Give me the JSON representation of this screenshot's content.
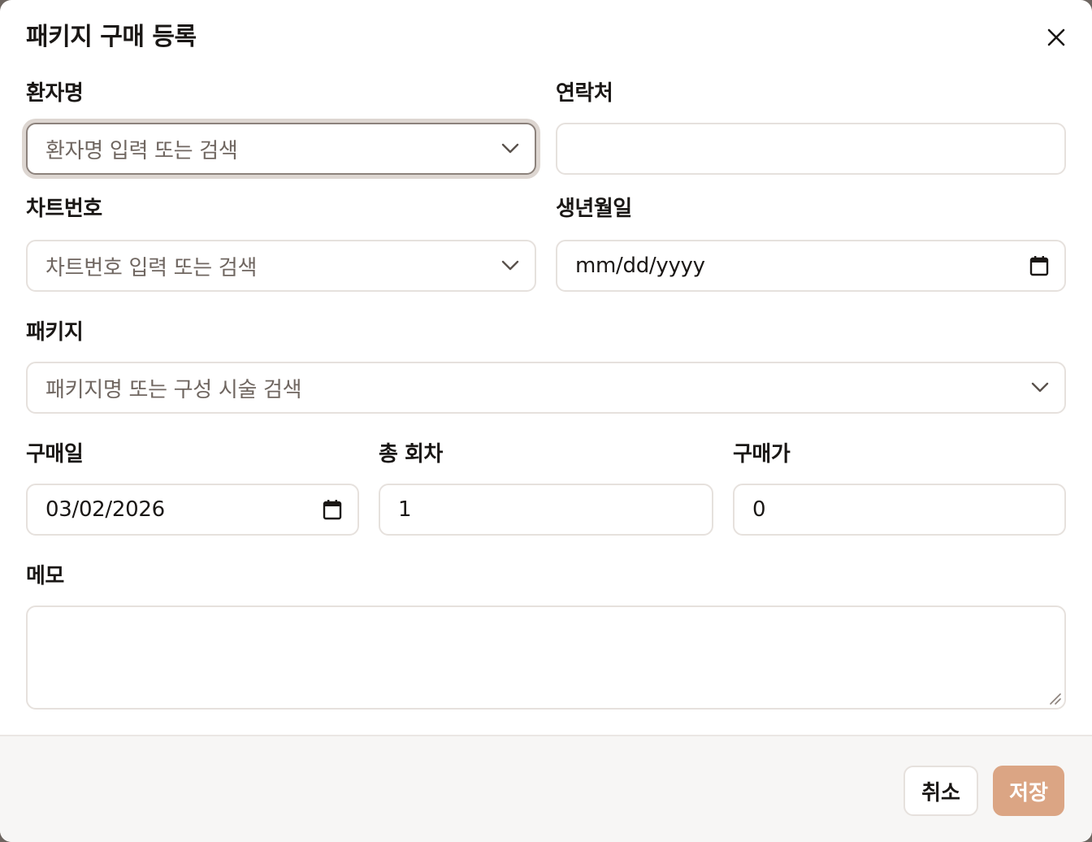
{
  "dialog": {
    "title": "패키지 구매 등록"
  },
  "patient_name": {
    "label": "환자명",
    "placeholder": "환자명 입력 또는 검색"
  },
  "contact": {
    "label": "연락처",
    "value": ""
  },
  "chart_number": {
    "label": "차트번호",
    "placeholder": "차트번호 입력 또는 검색"
  },
  "birth_date": {
    "label": "생년월일",
    "value": "mm/dd/yyyy"
  },
  "package": {
    "label": "패키지",
    "placeholder": "패키지명 또는 구성 시술 검색"
  },
  "purchase_date": {
    "label": "구매일",
    "value": "03/02/2026"
  },
  "total_sessions": {
    "label": "총 회차",
    "value": "1"
  },
  "purchase_price": {
    "label": "구매가",
    "value": "0"
  },
  "memo": {
    "label": "메모",
    "value": ""
  },
  "footer": {
    "cancel_label": "취소",
    "save_label": "저장"
  },
  "icons": {
    "close": "close-icon",
    "dropdown": "chevron-down-icon",
    "calendar": "calendar-icon"
  },
  "colors": {
    "save_button": "#dba584",
    "focus_ring": "#ddd6d1",
    "footer_bg": "#f7f6f5"
  }
}
